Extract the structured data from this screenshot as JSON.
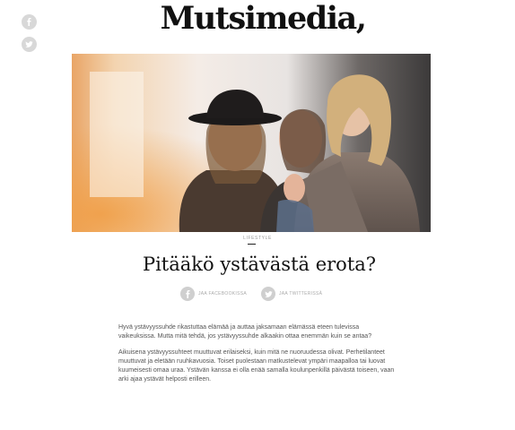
{
  "site": {
    "logo_text": "Mutsimedia,"
  },
  "side_share": {
    "icons": [
      "facebook-icon",
      "twitter-icon"
    ]
  },
  "hero": {
    "alt": "Kolme naista nauraa yhdessä"
  },
  "article": {
    "category": "Lifestyle",
    "title": "Pitääkö ystävästä erota?",
    "share_facebook_label": "Jaa Facebookissa",
    "share_twitter_label": "Jaa Twitterissä",
    "paragraphs": [
      "Hyvä ystävyyssuhde rikastuttaa elämää ja auttaa jaksamaan elämässä eteen tulevissa vaikeuksissa. Mutta mitä tehdä, jos ystävyyssuhde alkaakin ottaa enemmän kuin se antaa?",
      "Aikuisena ystävyyssuhteet muuttuvat erilaiseksi, kuin mitä ne nuoruudessa olivat. Perhetilanteet muuttuvat ja eletään ruuhkavuosia. Toiset puolestaan matkustelevat ympäri maapalloa tai luovat kuumeisesti omaa uraa. Ystävän kanssa ei olla enää samalla koulunpenkillä päivästä toiseen, vaan arki ajaa ystävät helposti erilleen."
    ]
  },
  "colors": {
    "icon_bg": "#d8d8d8",
    "text": "#555555",
    "title": "#111111"
  }
}
